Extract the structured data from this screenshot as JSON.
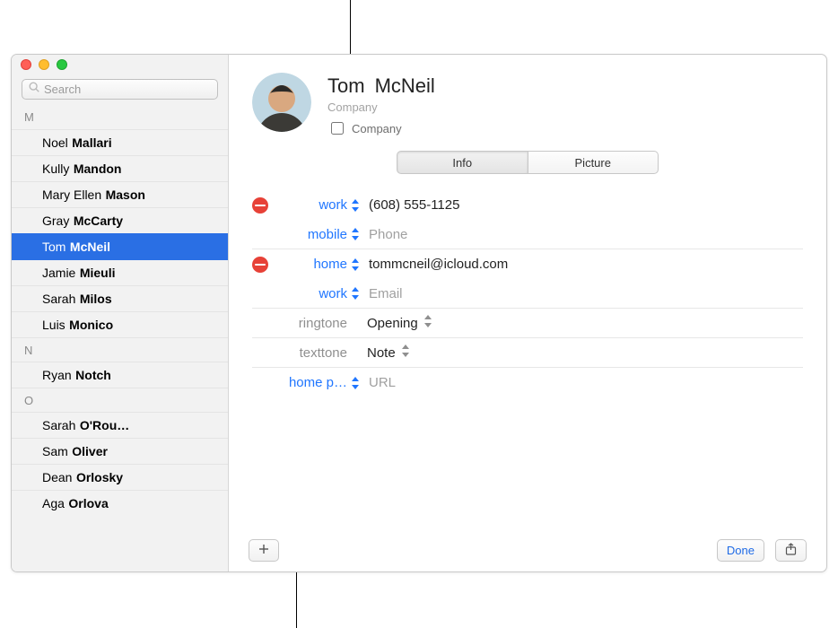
{
  "search": {
    "placeholder": "Search"
  },
  "contacts": {
    "groups": [
      {
        "letter": "M",
        "items": [
          {
            "first": "Noel",
            "last": "Mallari",
            "selected": false
          },
          {
            "first": "Kully",
            "last": "Mandon",
            "selected": false
          },
          {
            "first": "Mary Ellen",
            "last": "Mason",
            "selected": false
          },
          {
            "first": "Gray",
            "last": "McCarty",
            "selected": false
          },
          {
            "first": "Tom",
            "last": "McNeil",
            "selected": true
          },
          {
            "first": "Jamie",
            "last": "Mieuli",
            "selected": false
          },
          {
            "first": "Sarah",
            "last": "Milos",
            "selected": false
          },
          {
            "first": "Luis",
            "last": "Monico",
            "selected": false
          }
        ]
      },
      {
        "letter": "N",
        "items": [
          {
            "first": "Ryan",
            "last": "Notch",
            "selected": false
          }
        ]
      },
      {
        "letter": "O",
        "items": [
          {
            "first": "Sarah",
            "last": "O'Rou…",
            "selected": false
          },
          {
            "first": "Sam",
            "last": "Oliver",
            "selected": false
          },
          {
            "first": "Dean",
            "last": "Orlosky",
            "selected": false
          },
          {
            "first": "Aga",
            "last": "Orlova",
            "selected": false
          }
        ]
      }
    ]
  },
  "card": {
    "first_name": "Tom",
    "last_name": "McNeil",
    "company_placeholder": "Company",
    "company_checkbox_label": "Company"
  },
  "tabs": {
    "info": "Info",
    "picture": "Picture",
    "active": "info"
  },
  "fields": {
    "rows": [
      {
        "kind": "phone",
        "label": "work",
        "value": "(608) 555-1125",
        "placeholder": "",
        "removable": true,
        "muted": false
      },
      {
        "kind": "phone",
        "label": "mobile",
        "value": "",
        "placeholder": "Phone",
        "removable": false,
        "muted": false
      },
      {
        "kind": "email",
        "label": "home",
        "value": "tommcneil@icloud.com",
        "placeholder": "",
        "removable": true,
        "muted": false
      },
      {
        "kind": "email",
        "label": "work",
        "value": "",
        "placeholder": "Email",
        "removable": false,
        "muted": false
      },
      {
        "kind": "ringtone",
        "label": "ringtone",
        "value": "Opening",
        "placeholder": "",
        "removable": false,
        "muted": true,
        "picker": true
      },
      {
        "kind": "texttone",
        "label": "texttone",
        "value": "Note",
        "placeholder": "",
        "removable": false,
        "muted": true,
        "picker": true
      },
      {
        "kind": "url",
        "label": "home p…",
        "value": "",
        "placeholder": "URL",
        "removable": false,
        "muted": false
      }
    ]
  },
  "footer": {
    "done_label": "Done"
  }
}
